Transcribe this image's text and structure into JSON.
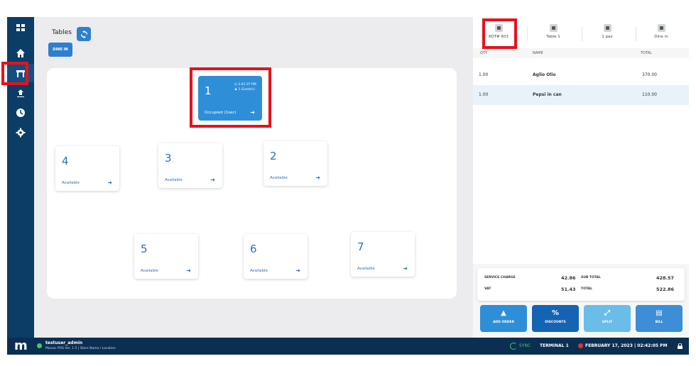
{
  "colors": {
    "sidebar": "#0b3d66",
    "accent": "#2e8fd8",
    "highlight": "#e8111c",
    "online": "#3ccf5a"
  },
  "sidebar": {
    "items": [
      {
        "icon": "grid-icon",
        "label": "Menu"
      },
      {
        "icon": "home-icon",
        "label": "Home"
      },
      {
        "icon": "table-icon",
        "label": "Tables"
      },
      {
        "icon": "inventory-icon",
        "label": "Reports"
      },
      {
        "icon": "clock-icon",
        "label": "History"
      },
      {
        "icon": "gear-icon",
        "label": "Settings"
      }
    ]
  },
  "header": {
    "title": "Tables",
    "dine_in": "DINE IN"
  },
  "tables": [
    {
      "number": "1",
      "status": "Occupied (1sec)",
      "time": "2:41:37 PM",
      "guests": "1 Guest(s)"
    },
    {
      "number": "4",
      "status": "Available"
    },
    {
      "number": "3",
      "status": "Available"
    },
    {
      "number": "2",
      "status": "Available"
    },
    {
      "number": "5",
      "status": "Available"
    },
    {
      "number": "6",
      "status": "Available"
    },
    {
      "number": "7",
      "status": "Available"
    }
  ],
  "order_panel": {
    "tabs": [
      {
        "label": "KOT# 603",
        "icon": "receipt-icon"
      },
      {
        "label": "Table 1",
        "icon": "chair-icon"
      },
      {
        "label": "1 pax",
        "icon": "person-icon"
      },
      {
        "label": "Dine in",
        "icon": "dine-in-icon"
      }
    ],
    "columns": {
      "qty": "QTY",
      "name": "NAME",
      "total": "TOTAL"
    },
    "items": [
      {
        "qty": "1.00",
        "name": "Aglio Olio",
        "total": "370.00"
      },
      {
        "qty": "1.00",
        "name": "Pepsi in can",
        "total": "110.00"
      }
    ],
    "summary": {
      "service_charge_label": "SERVICE CHARGE",
      "service_charge": "42.86",
      "sub_total_label": "SUB TOTAL",
      "sub_total": "428.57",
      "vat_label": "VAT",
      "vat": "51.43",
      "total_label": "TOTAL",
      "total": "522.86"
    },
    "actions": [
      {
        "label": "ADD ORDER",
        "color": "#2e8fd8",
        "icon": "add-order-icon"
      },
      {
        "label": "DISCOUNTS",
        "color": "#1564b3",
        "icon": "percent-icon"
      },
      {
        "label": "SPLIT",
        "color": "#6bbde9",
        "icon": "split-icon"
      },
      {
        "label": "BILL",
        "color": "#3d8ed6",
        "icon": "bill-icon"
      }
    ]
  },
  "status_bar": {
    "logo": "m",
    "user": "testuser_admin",
    "subtitle": "Mosaic POS Ver. 1.5 | Store Name / Location",
    "sync": "SYNC",
    "terminal": "TERMINAL 1",
    "datetime": "FEBRUARY 17, 2023 | 02:42:05 PM"
  }
}
